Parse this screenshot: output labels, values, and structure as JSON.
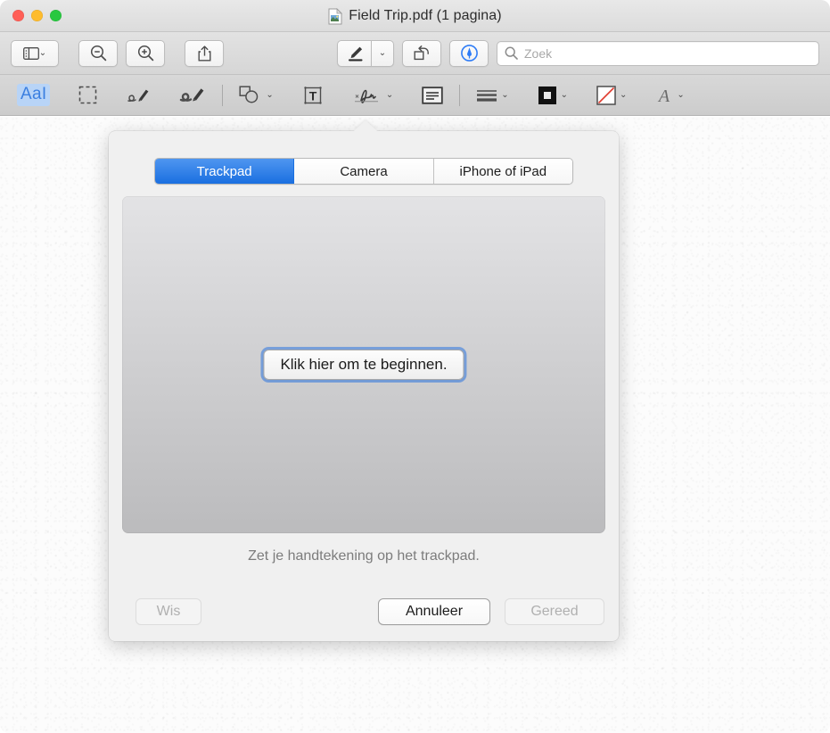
{
  "window": {
    "title": "Field Trip.pdf (1 pagina)",
    "doc_icon": "pdf-document-icon",
    "traffic_lights": [
      {
        "name": "close",
        "color": "#ff5f57"
      },
      {
        "name": "minimize",
        "color": "#febc2e"
      },
      {
        "name": "zoom",
        "color": "#28c840"
      }
    ]
  },
  "toolbar": {
    "sidebar_icon": "sidebar-icon",
    "sidebar_chevron": "chevron-down-icon",
    "zoom_out_icon": "zoom-out-icon",
    "zoom_in_icon": "zoom-in-icon",
    "share_icon": "share-icon",
    "highlight_icon": "highlighter-pen-icon",
    "highlight_chevron": "chevron-down-icon",
    "rotate_icon": "rotate-left-icon",
    "markup_icon": "markup-pen-icon",
    "markup_accent": "#2f7cf6"
  },
  "search": {
    "icon": "search-icon",
    "placeholder": "Zoek",
    "value": ""
  },
  "markup_tools": {
    "text_selection_label": "AaI",
    "text_selection_accent": "#3b7fe0",
    "rect_selection_icon": "rectangular-selection-icon",
    "sketch_icon": "sketch-icon",
    "draw_icon": "draw-icon",
    "shapes_icon": "shapes-icon",
    "text_icon": "text-box-icon",
    "signature_icon": "signature-icon",
    "note_icon": "note-icon",
    "border_style_icon": "border-style-icon",
    "border_color_icon": "border-color-swatch-icon",
    "fill_color_icon": "fill-color-none-icon",
    "text_style_icon": "text-style-icon",
    "chevron": "⌄",
    "fill_none_stroke": "#e03b2f"
  },
  "signature_popover": {
    "tabs": [
      {
        "label": "Trackpad",
        "selected": true
      },
      {
        "label": "Camera",
        "selected": false
      },
      {
        "label": "iPhone of iPad",
        "selected": false
      }
    ],
    "start_button_label": "Klik hier om te beginnen.",
    "hint_text": "Zet je handtekening op het trackpad.",
    "buttons": {
      "clear": {
        "label": "Wis",
        "enabled": false
      },
      "cancel": {
        "label": "Annuleer",
        "enabled": true
      },
      "done": {
        "label": "Gereed",
        "enabled": false
      }
    },
    "selected_tab_color": "#1a6fe0",
    "focus_ring_color": "#588edc"
  }
}
